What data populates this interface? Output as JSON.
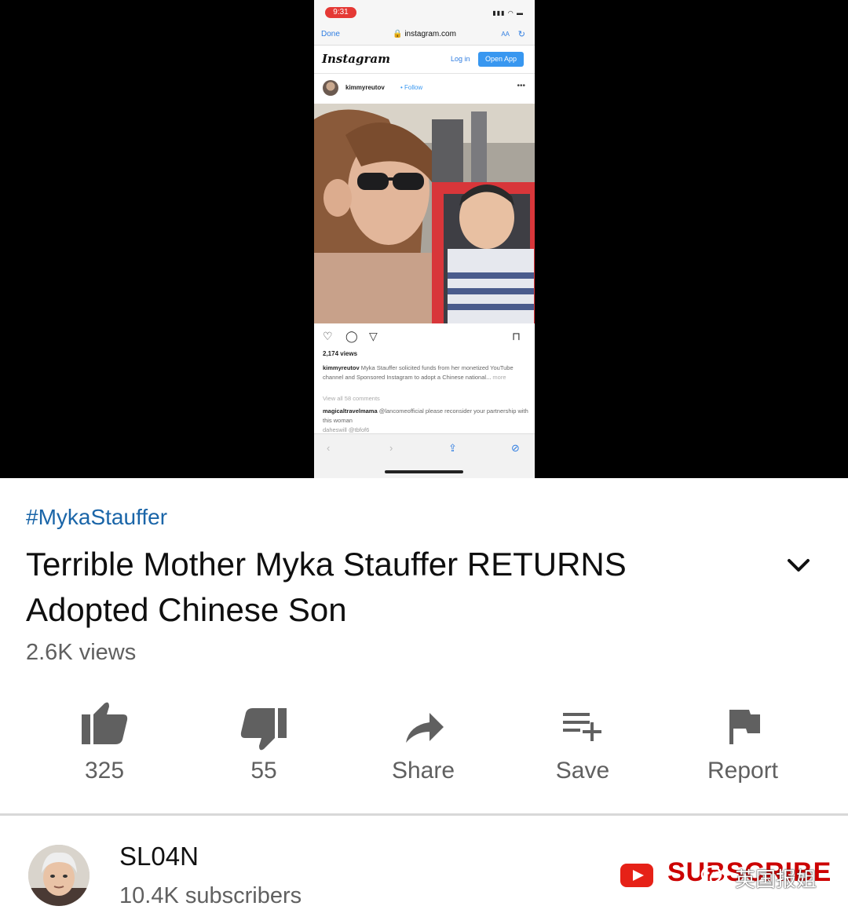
{
  "player": {
    "status_time": "9:31",
    "browser": {
      "done_label": "Done",
      "url": "instagram.com",
      "aa_label": "AA"
    },
    "instagram": {
      "logo_text": "Instagram",
      "login_label": "Log in",
      "open_app_label": "Open App",
      "username": "kimmyreutov",
      "follow_label": "Follow",
      "views": "2,174 views",
      "caption_user": "kimmyreutov",
      "caption_text": "Myka Stauffer solicited funds from her monetized YouTube channel and Sponsored Instagram to adopt a Chinese national...",
      "caption_more": "more",
      "view_comments": "View all 58 comments",
      "comment_user": "magicaltravelmama",
      "comment_text": "@lancomeofficial please reconsider your partnership with this woman",
      "comment_tail": "daheswill @tbfof6"
    }
  },
  "video": {
    "hashtag": "#MykaStauffer",
    "title": "Terrible Mother Myka Stauffer RETURNS Adopted Chinese Son",
    "views": "2.6K views"
  },
  "actions": [
    {
      "id": "like",
      "label": "325",
      "icon": "thumbs-up-icon"
    },
    {
      "id": "dislike",
      "label": "55",
      "icon": "thumbs-down-icon"
    },
    {
      "id": "share",
      "label": "Share",
      "icon": "share-arrow-icon"
    },
    {
      "id": "save",
      "label": "Save",
      "icon": "playlist-add-icon"
    },
    {
      "id": "report",
      "label": "Report",
      "icon": "flag-icon"
    }
  ],
  "channel": {
    "name": "SL04N",
    "subscribers": "10.4K subscribers",
    "subscribe_label": "SUBSCRIBE"
  },
  "watermark": "英国报姐",
  "colors": {
    "hashtag": "#1a65a8",
    "subscribe": "#cc0000",
    "icon_gray": "#606060",
    "instagram_blue": "#3897f0"
  }
}
